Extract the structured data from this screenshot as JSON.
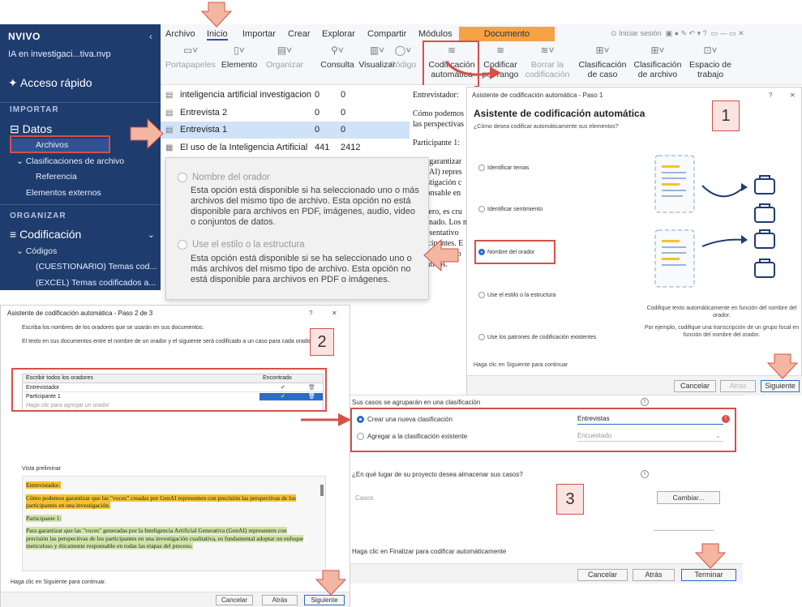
{
  "sidebar": {
    "app_name": "NVIVO",
    "project": "IA en investigaci...tiva.nvp",
    "quick_access": "Acceso rápido",
    "sections": [
      "IMPORTAR",
      "ORGANIZAR"
    ],
    "datos": "Datos",
    "archivos": "Archivos",
    "clasificaciones": "Clasificaciones de archivo",
    "referencia": "Referencia",
    "externos": "Elementos externos",
    "codificacion": "Codificación",
    "codigos": "Códigos",
    "code1": "(CUESTIONARIO) Temas cod...",
    "code2": "(EXCEL) Temas codificados a..."
  },
  "ribbon": {
    "tabs": [
      "Archivo",
      "Inicio",
      "Importar",
      "Crear",
      "Explorar",
      "Compartir",
      "Módulos"
    ],
    "context_tab": "Documento",
    "top_right": "Iniciar sesión",
    "buttons": [
      "Portapapeles",
      "Elemento",
      "Organizar",
      "Consulta",
      "Visualizar",
      "Códigos",
      "Codificación automática",
      "Codificar por rango",
      "Borrar la codificación",
      "Clasificación de caso",
      "Clasificación de archivo",
      "Espacio de trabajo"
    ]
  },
  "files": [
    {
      "name": "inteligencia artificial investigacion",
      "a": "0",
      "b": "0"
    },
    {
      "name": "Entrevista 2",
      "a": "0",
      "b": "0"
    },
    {
      "name": "Entrevista 1",
      "a": "0",
      "b": "0"
    },
    {
      "name": "El uso de la Inteligencia Artificial",
      "a": "441",
      "b": "2412"
    }
  ],
  "doc_preview": [
    "Entrevistador:",
    "Cómo podemos",
    "las perspectivas",
    "Participante 1:",
    "Para garantizar",
    "(GenAI) repres",
    "investigación c",
    "responsable en",
    "Primero, es cru",
    "entrenado. Los m",
    "representativo",
    "participantes. E",
    "para evitar la o",
    "auténticos."
  ],
  "popup": {
    "opt1": "Nombre del orador",
    "desc1": "Esta opción está disponible si ha seleccionado uno o más archivos del mismo tipo de archivo. Esta opción no está disponible para archivos en PDF, imágenes, audio, video o conjuntos de datos.",
    "opt2": "Use el estilo o la estructura",
    "desc2": "Esta opción está disponible si se ha seleccionado uno o más archivos del mismo tipo de archivo. Esta opción no está disponible para archivos en PDF o imágenes."
  },
  "step1": {
    "window_title": "Asistente de codificación automática - Paso 1",
    "heading": "Asistente de codificación automática",
    "question": "¿Cómo desea codificar automáticamente sus elementos?",
    "options": [
      "Identificar temas",
      "Identificar sentimiento",
      "Nombre del orador",
      "Use el estilo o la estructura",
      "Use los patrones de codificación existentes"
    ],
    "caption1": "Codifique texto automáticamente en función del nombre del orador.",
    "caption2": "Por ejemplo, codifique una transcripción de un grupo focal en función del nombre del orador.",
    "hint": "Haga clic en Siguiente para continuar",
    "cancel": "Cancelar",
    "back": "Atrás",
    "next": "Siguiente",
    "help": "?",
    "close": "✕"
  },
  "step2": {
    "window_title": "Asistente de codificación automática - Paso 2 de 3",
    "text1": "Escriba los nombres de los oradores que se usarán en sus documentos.",
    "text2": "El texto en sus documentos entre el nombre de un orador y el siguiente será codificado a un caso para cada orador.",
    "col1": "Escribir todos los oradores",
    "col2": "Encontrado",
    "speakers": [
      "Entrevistador",
      "Participante 1"
    ],
    "add_hint": "Haga clic para agregar un orador",
    "preview_label": "Vista preliminar",
    "preview": {
      "p1": "Entrevistador:",
      "p2": "Cómo podemos garantizar que las \"voces\" creadas por GenAI representen con precisión las perspectivas de los participantes en una investigación.",
      "p3": "Participante 1:",
      "p4": "Para garantizar que las \"voces\" generadas por la Inteligencia Artificial Generativa (GenAI) representen con precisión las perspectivas de los participantes en una investigación cualitativa, es fundamental adoptar un enfoque meticuloso y éticamente responsable en todas las etapas del proceso."
    },
    "hint": "Haga clic en Siguiente para continuar.",
    "cancel": "Cancelar",
    "back": "Atrás",
    "next": "Siguiente"
  },
  "step3": {
    "q1": "Sus casos se agruparán en una clasificación",
    "opt_new": "Crear una nueva clasificación",
    "opt_existing": "Agregar a la clasificación existente",
    "new_value": "Entrevistas",
    "existing_value": "Encuestado",
    "q2": "¿En qué lugar de su proyecto desea almacenar sus casos?",
    "casos": "Casos",
    "change": "Cambiar...",
    "hint": "Haga clic en Finalizar para codificar automáticamente",
    "cancel": "Cancelar",
    "back": "Atrás",
    "finish": "Terminar"
  },
  "numbers": [
    "1",
    "2",
    "3"
  ],
  "colors": {
    "sidebar": "#1f3c6e",
    "accent": "#2b6cc4",
    "callout": "#d4514a",
    "arrow": "#f3b6a0",
    "context_tab": "#f5a244"
  }
}
